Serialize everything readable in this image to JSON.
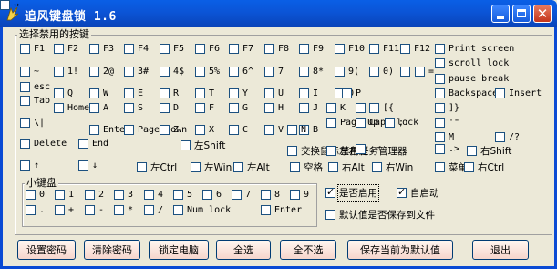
{
  "window": {
    "title": "追风键盘锁 1.6"
  },
  "group_main": {
    "title": "选择禁用的按键"
  },
  "group_numpad": {
    "title": "小键盘"
  },
  "keys": [
    {
      "l": "F1"
    },
    {
      "l": "F2"
    },
    {
      "l": "F3"
    },
    {
      "l": "F4"
    },
    {
      "l": "F5"
    },
    {
      "l": "F6"
    },
    {
      "l": "F7"
    },
    {
      "l": "F8"
    },
    {
      "l": "F9"
    },
    {
      "l": "F10"
    },
    {
      "l": "F11"
    },
    {
      "l": "F12"
    },
    {
      "l": "Print screen"
    },
    {
      "l": "~"
    },
    {
      "l": "1!"
    },
    {
      "l": "2@"
    },
    {
      "l": "3#"
    },
    {
      "l": "4$"
    },
    {
      "l": "5%"
    },
    {
      "l": "6^"
    },
    {
      "l": "7"
    },
    {
      "l": "8*"
    },
    {
      "l": "9("
    },
    {
      "l": "0)"
    },
    {
      "l": "-"
    },
    {
      "l": "="
    },
    {
      "l": "scroll lock"
    },
    {
      "l": "pause break"
    },
    {
      "l": "esc"
    },
    {
      "l": "Tab"
    },
    {
      "l": "Q"
    },
    {
      "l": "W"
    },
    {
      "l": "E"
    },
    {
      "l": "R"
    },
    {
      "l": "T"
    },
    {
      "l": "Y"
    },
    {
      "l": "U"
    },
    {
      "l": "I"
    },
    {
      "l": "O"
    },
    {
      "l": "P"
    },
    {
      "l": "Backspace"
    },
    {
      "l": "Insert"
    },
    {
      "l": "Home"
    },
    {
      "l": "A"
    },
    {
      "l": "S"
    },
    {
      "l": "D"
    },
    {
      "l": "F"
    },
    {
      "l": "G"
    },
    {
      "l": "H"
    },
    {
      "l": "J"
    },
    {
      "l": "K"
    },
    {
      "l": "L"
    },
    {
      "l": "[{"
    },
    {
      "l": "]}"
    },
    {
      "l": "\\|"
    },
    {
      "l": "Page Up"
    },
    {
      "l": "Caps lock"
    },
    {
      "l": ";:"
    },
    {
      "l": "'\""
    },
    {
      "l": "Enter"
    },
    {
      "l": "Page Down"
    },
    {
      "l": "Z"
    },
    {
      "l": "X"
    },
    {
      "l": "C"
    },
    {
      "l": "V"
    },
    {
      "l": "B"
    },
    {
      "l": "N"
    },
    {
      "l": "M"
    },
    {
      "l": "/?"
    },
    {
      "l": "Delete"
    },
    {
      "l": "End"
    },
    {
      "l": "左Shift"
    },
    {
      "l": "交换鼠标左右键"
    },
    {
      "l": "禁用任务管理器"
    },
    {
      "l": ",<"
    },
    {
      "l": ".>"
    },
    {
      "l": "右Shift"
    },
    {
      "l": "↑"
    },
    {
      "l": "↓"
    },
    {
      "l": "左Ctrl"
    },
    {
      "l": "左Win"
    },
    {
      "l": "左Alt"
    },
    {
      "l": "空格"
    },
    {
      "l": "右Alt"
    },
    {
      "l": "右Win"
    },
    {
      "l": "菜单"
    },
    {
      "l": "右Ctrl"
    },
    {
      "l": "←"
    },
    {
      "l": "→"
    }
  ],
  "numpad": [
    {
      "l": "0"
    },
    {
      "l": "1"
    },
    {
      "l": "2"
    },
    {
      "l": "3"
    },
    {
      "l": "4"
    },
    {
      "l": "5"
    },
    {
      "l": "6"
    },
    {
      "l": "7"
    },
    {
      "l": "8"
    },
    {
      "l": "9"
    },
    {
      "l": "."
    },
    {
      "l": "+"
    },
    {
      "l": "-"
    },
    {
      "l": "*"
    },
    {
      "l": "/"
    },
    {
      "l": "Num lock"
    },
    {
      "l": "Enter"
    }
  ],
  "options": {
    "enabled": "是否启用",
    "autostart": "自启动",
    "save_default": "默认值是否保存到文件"
  },
  "buttons": {
    "set_password": "设置密码",
    "clear_password": "清除密码",
    "lock_pc": "锁定电脑",
    "select_all": "全选",
    "select_none": "全不选",
    "save_default": "保存当前为默认值",
    "exit": "退出"
  }
}
